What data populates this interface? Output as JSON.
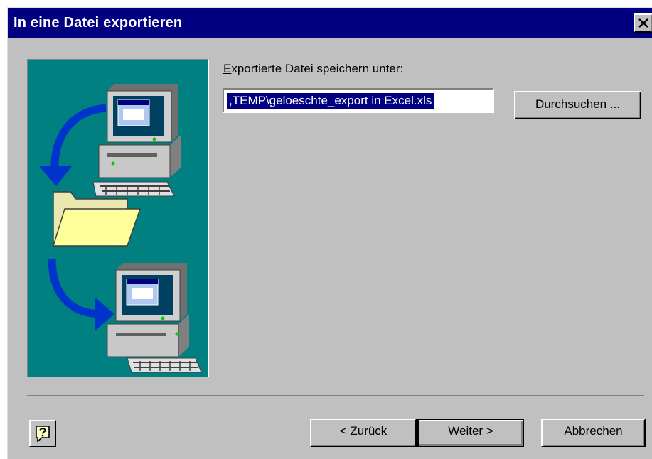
{
  "window": {
    "title": "In eine Datei exportieren",
    "close_glyph": "close-icon"
  },
  "form": {
    "label_mnemonic": "E",
    "label_rest": "xportierte Datei speichern unter:",
    "path_value": ",TEMP\\geloeschte_export in Excel.xls"
  },
  "buttons": {
    "browse": {
      "before": "Dur",
      "mnemonic": "c",
      "after": "hsuchen ..."
    },
    "back": {
      "before": "< ",
      "mnemonic": "Z",
      "after": "urück"
    },
    "next": {
      "before": "",
      "mnemonic": "W",
      "after": "eiter >"
    },
    "cancel": "Abbrechen",
    "help_icon": "help-icon"
  },
  "illustration": {
    "icons": [
      "computer-icon",
      "arrow-icon",
      "folder-icon",
      "computer-icon",
      "arrow-icon"
    ]
  },
  "colors": {
    "titlebar": "#000080",
    "face": "#c0c0c0",
    "art_bg": "#008080",
    "selection": "#000080",
    "folder": "#ffff99",
    "arrow": "#0033cc"
  }
}
